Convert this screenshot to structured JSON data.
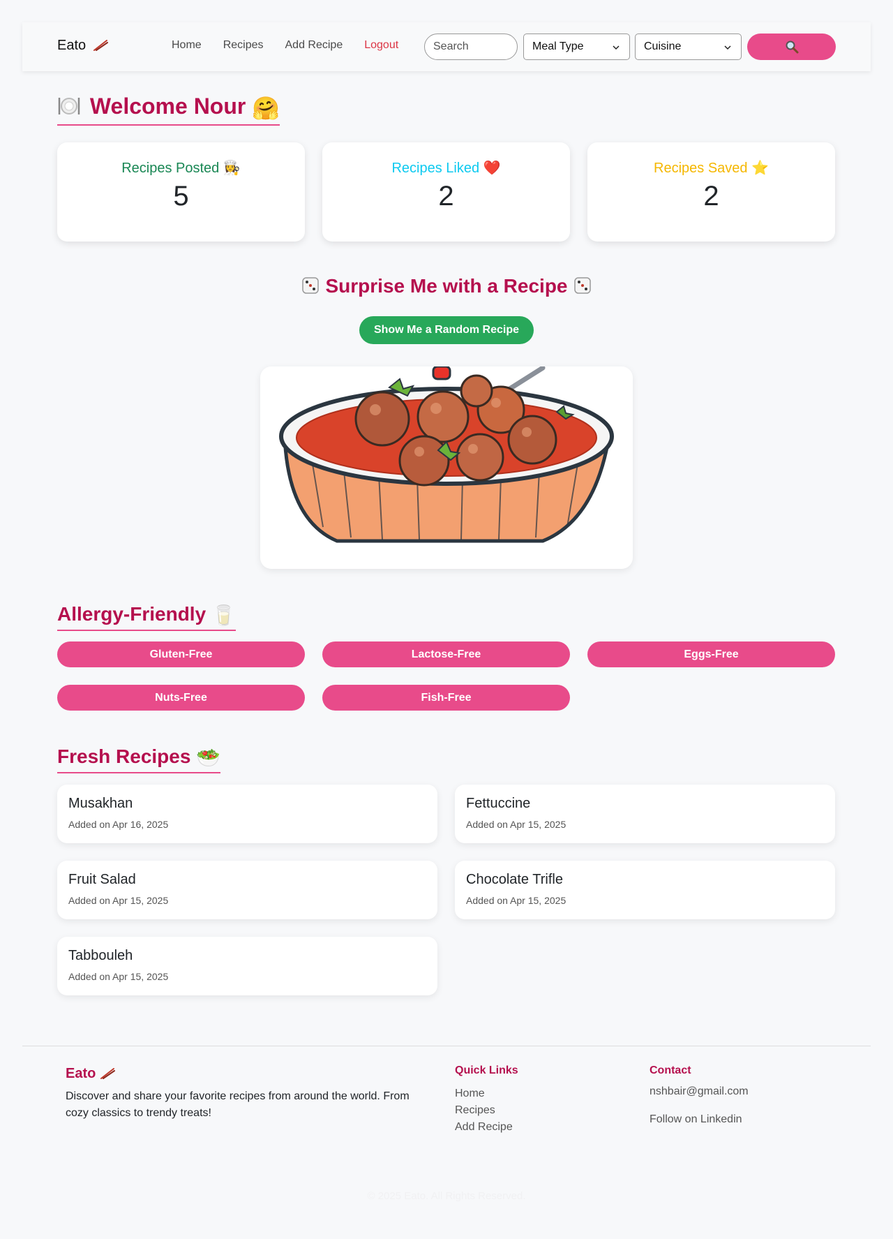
{
  "nav": {
    "brand": "Eato",
    "links": [
      "Home",
      "Recipes",
      "Add Recipe",
      "Logout"
    ],
    "search_placeholder": "Search",
    "meal_type": "Meal Type",
    "cuisine": "Cuisine",
    "search_button_icon": "magnifier-icon"
  },
  "welcome": {
    "title": "Welcome Nour",
    "emoji": "🤗"
  },
  "stats": [
    {
      "label": "Recipes Posted",
      "emoji": "👩‍🍳",
      "value": "5",
      "color": "#198754"
    },
    {
      "label": "Recipes Liked",
      "emoji": "❤️",
      "value": "2",
      "color": "#0dcaf0"
    },
    {
      "label": "Recipes Saved",
      "emoji": "⭐",
      "value": "2",
      "color": "#f5b700"
    }
  ],
  "surprise": {
    "title": "Surprise Me with a Recipe",
    "button": "Show Me a Random Recipe",
    "image": "meatball-soup-illustration"
  },
  "allergy": {
    "title": "Allergy-Friendly",
    "emoji": "🥛",
    "items": [
      "Gluten-Free",
      "Lactose-Free",
      "Eggs-Free",
      "Nuts-Free",
      "Fish-Free"
    ]
  },
  "fresh": {
    "title": "Fresh Recipes",
    "emoji": "🥗",
    "recipes": [
      {
        "name": "Musakhan",
        "date": "Added on Apr 16, 2025"
      },
      {
        "name": "Fettuccine",
        "date": "Added on Apr 15, 2025"
      },
      {
        "name": "Fruit Salad",
        "date": "Added on Apr 15, 2025"
      },
      {
        "name": "Chocolate Trifle",
        "date": "Added on Apr 15, 2025"
      },
      {
        "name": "Tabbouleh",
        "date": "Added on Apr 15, 2025"
      }
    ]
  },
  "footer": {
    "brand": "Eato",
    "description": "Discover and share your favorite recipes from around the world. From cozy classics to trendy treats!",
    "quick_links_title": "Quick Links",
    "quick_links": [
      "Home",
      "Recipes",
      "Add Recipe"
    ],
    "contact_title": "Contact",
    "email": "nshbair@gmail.com",
    "linkedin": "Follow on Linkedin",
    "copyright": "© 2025 Eato. All Rights Reserved."
  },
  "colors": {
    "accent": "#e84b8a",
    "heading": "#b5104e",
    "success": "#28a85a",
    "danger": "#dc3545"
  }
}
